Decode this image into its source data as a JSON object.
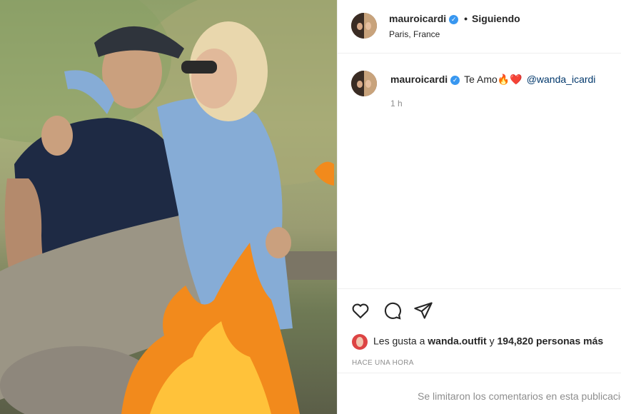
{
  "post": {
    "username": "mauroicardi",
    "verified_icon": "verified-badge-icon",
    "separator": "•",
    "follow_status": "Siguiendo",
    "location": "Paris, France"
  },
  "caption": {
    "username": "mauroicardi",
    "text": "Te Amo🔥❤️",
    "mention": "@wanda_icardi",
    "time": "1 h"
  },
  "actions": {
    "like_icon": "heart-icon",
    "comment_icon": "comment-icon",
    "share_icon": "paper-plane-icon"
  },
  "likes": {
    "prefix": "Les gusta a",
    "user": "wanda.outfit",
    "connector": "y",
    "count": "194,820 personas más"
  },
  "timestamp": "HACE UNA HORA",
  "comments": {
    "limited_text": "Se limitaron los comentarios en esta publicación."
  },
  "colors": {
    "accent_blue": "#3897f0",
    "mention_blue": "#00376b",
    "muted": "#8e8e8e"
  }
}
